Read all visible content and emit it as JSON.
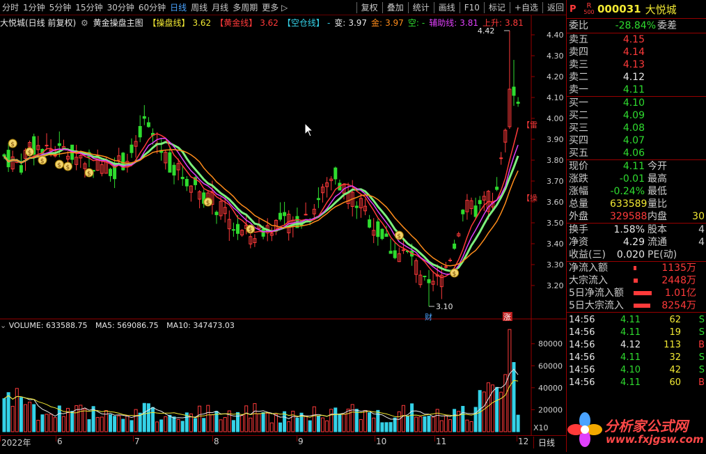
{
  "toolbar": {
    "periods": [
      "分时",
      "1分钟",
      "5分钟",
      "15分钟",
      "30分钟",
      "60分钟",
      "日线",
      "周线",
      "月线",
      "多周期",
      "更多 ▷"
    ],
    "active_period": "日线",
    "tools": [
      "复权",
      "叠加",
      "统计",
      "画线",
      "F10",
      "标记",
      "+自选",
      "返回"
    ]
  },
  "chart_info": {
    "title": "大悦城(日线 前复权)",
    "formula_name": "黄金操盘主图",
    "items": [
      {
        "label": "【操盘线】",
        "value": "3.62",
        "color": "#f2e933"
      },
      {
        "label": "【黄金线】",
        "value": "3.62",
        "color": "#ff3a3a"
      },
      {
        "label": "【空仓线】",
        "value": "-",
        "color": "#34d2e8"
      },
      {
        "label": "变:",
        "value": "3.97",
        "color": "#e8e8e8"
      },
      {
        "label": "金:",
        "value": "3.97",
        "color": "#ff8c1a"
      },
      {
        "label": "空:",
        "value": "-",
        "color": "#2fdc2f"
      },
      {
        "label": "辅助线:",
        "value": "3.81",
        "color": "#e040fb"
      },
      {
        "label": "上升:",
        "value": "3.81",
        "color": "#ff3a3a"
      }
    ]
  },
  "price_axis": [
    "4.40",
    "4.30",
    "4.20",
    "4.10",
    "4.00",
    "3.90",
    "3.80",
    "3.70",
    "3.60",
    "3.50",
    "3.40",
    "3.30",
    "3.20"
  ],
  "annotations": {
    "high": "4.42",
    "low": "3.10",
    "finance_tag": "财",
    "rise_tag": "涨",
    "side_label_1": "【雷",
    "side_label_2": "【操"
  },
  "volume": {
    "label": "VOLUME: 633588.75",
    "ma5": "MA5: 569086.75",
    "ma10": "MA10: 347473.03",
    "axis": [
      "80000",
      "60000",
      "40000",
      "20000"
    ],
    "unit": "X10"
  },
  "x_axis": {
    "labels": [
      "2022年",
      "6",
      "7",
      "8",
      "9",
      "10",
      "11",
      "12"
    ],
    "period": "日线"
  },
  "chart_data": {
    "type": "candlestick",
    "price_ylim": [
      3.1,
      4.44
    ],
    "volume_ylim": [
      0,
      95000
    ],
    "high": 4.42,
    "low": 3.1,
    "last_close": 4.11
  },
  "quote": {
    "code": "000031",
    "name": "大悦城",
    "r_badge": "R",
    "r_sub": "500",
    "p_badge": "P",
    "weibi_label": "委比",
    "weibi_value": "-28.84%",
    "weicha_label": "委差",
    "asks": [
      {
        "label": "卖五",
        "price": "4.15",
        "color": "#ff3a3a"
      },
      {
        "label": "卖四",
        "price": "4.14",
        "color": "#ff3a3a"
      },
      {
        "label": "卖三",
        "price": "4.13",
        "color": "#ff3a3a"
      },
      {
        "label": "卖二",
        "price": "4.12",
        "color": "#e8e8e8"
      },
      {
        "label": "卖一",
        "price": "4.11",
        "color": "#2fdc2f"
      }
    ],
    "bids": [
      {
        "label": "买一",
        "price": "4.10",
        "color": "#2fdc2f"
      },
      {
        "label": "买二",
        "price": "4.09",
        "color": "#2fdc2f"
      },
      {
        "label": "买三",
        "price": "4.08",
        "color": "#2fdc2f"
      },
      {
        "label": "买四",
        "price": "4.07",
        "color": "#2fdc2f"
      },
      {
        "label": "买五",
        "price": "4.06",
        "color": "#2fdc2f"
      }
    ],
    "stats1": [
      {
        "l": "现价",
        "v": "4.11",
        "vc": "#2fdc2f",
        "r": "今开"
      },
      {
        "l": "涨跌",
        "v": "-0.01",
        "vc": "#2fdc2f",
        "r": "最高"
      },
      {
        "l": "涨幅",
        "v": "-0.24%",
        "vc": "#2fdc2f",
        "r": "最低"
      },
      {
        "l": "总量",
        "v": "633589",
        "vc": "#f2e933",
        "r": "量比"
      },
      {
        "l": "外盘",
        "v": "329588",
        "vc": "#ff3a3a",
        "r": "内盘",
        "rv": "30",
        "rvc": "#f2e933"
      }
    ],
    "stats2": [
      {
        "l": "换手",
        "v": "1.58%",
        "vc": "#e8e8e8",
        "r": "股本",
        "rv": "4"
      },
      {
        "l": "净资",
        "v": "4.29",
        "vc": "#e8e8e8",
        "r": "流通",
        "rv": "4"
      },
      {
        "l": "收益(三)",
        "v": "0.020",
        "vc": "#e8e8e8",
        "r": "PE(动)"
      }
    ],
    "flows": [
      {
        "l": "净流入额",
        "v": "1135万",
        "bar": 4
      },
      {
        "l": "大宗流入",
        "v": "2448万",
        "bar": 6
      },
      {
        "l": "5日净流入额",
        "v": "1.01亿",
        "bar": 26
      },
      {
        "l": "5日大宗流入",
        "v": "8254万",
        "bar": 24
      }
    ],
    "ticks": [
      {
        "t": "14:56",
        "p": "4.11",
        "pc": "#2fdc2f",
        "v": "62",
        "f": "S",
        "fc": "#2fdc2f"
      },
      {
        "t": "14:56",
        "p": "4.11",
        "pc": "#2fdc2f",
        "v": "19",
        "f": "S",
        "fc": "#2fdc2f"
      },
      {
        "t": "14:56",
        "p": "4.12",
        "pc": "#e8e8e8",
        "v": "113",
        "f": "B",
        "fc": "#ff3a3a"
      },
      {
        "t": "14:56",
        "p": "4.11",
        "pc": "#2fdc2f",
        "v": "32",
        "f": "S",
        "fc": "#2fdc2f"
      },
      {
        "t": "14:56",
        "p": "4.10",
        "pc": "#2fdc2f",
        "v": "42",
        "f": "S",
        "fc": "#2fdc2f"
      },
      {
        "t": "14:56",
        "p": "4.11",
        "pc": "#2fdc2f",
        "v": "60",
        "f": "B",
        "fc": "#ff3a3a"
      }
    ]
  },
  "watermark": {
    "cn": "分析家公式网",
    "url": "www.fxjgsw.com"
  }
}
